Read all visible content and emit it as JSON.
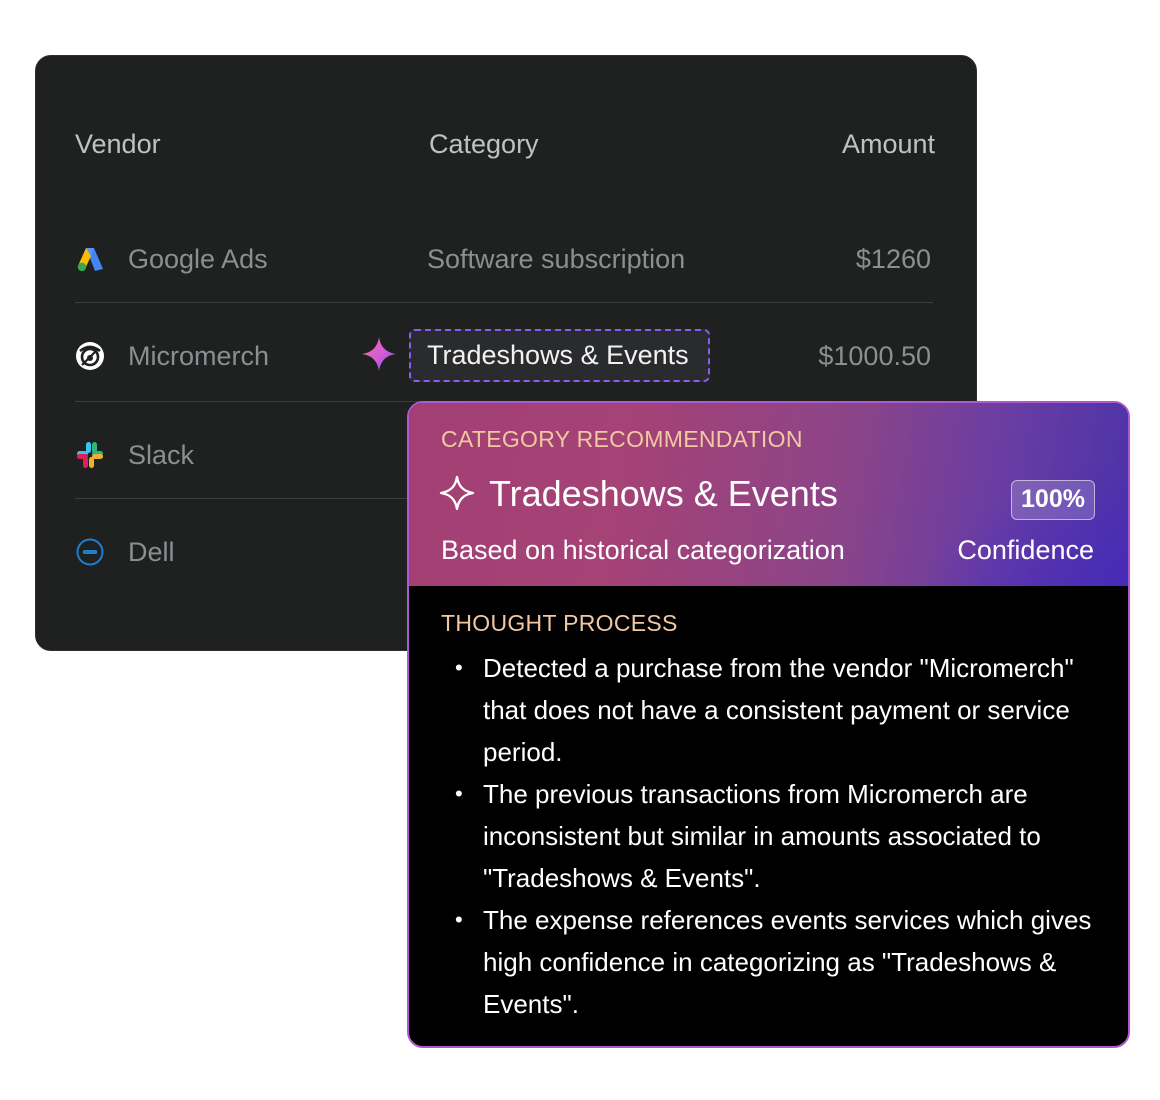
{
  "table": {
    "headers": {
      "vendor": "Vendor",
      "category": "Category",
      "amount": "Amount"
    },
    "rows": [
      {
        "vendor": "Google Ads",
        "icon": "google-ads-icon",
        "category": "Software subscription",
        "amount": "$1260"
      },
      {
        "vendor": "Micromerch",
        "icon": "micromerch-icon",
        "category": "Tradeshows & Events",
        "amount": "$1000.50"
      },
      {
        "vendor": "Slack",
        "icon": "slack-icon",
        "category": "",
        "amount": ""
      },
      {
        "vendor": "Dell",
        "icon": "dell-icon",
        "category": "",
        "amount": ""
      }
    ]
  },
  "recommendation": {
    "eyebrow": "CATEGORY RECOMMENDATION",
    "title": "Tradeshows & Events",
    "confidence_value": "100%",
    "subtitle": "Based on historical categorization",
    "confidence_label": "Confidence",
    "thought_title": "THOUGHT PROCESS",
    "thoughts": [
      "Detected a purchase from the vendor \"Micromerch\" that does not have a consistent payment or service period.",
      "The previous transactions from Micromerch are inconsistent but similar in amounts associated to \"Tradeshows & Events\".",
      "The expense references events services which gives high confidence in categorizing as \"Tradeshows & Events\"."
    ]
  },
  "colors": {
    "card_bg": "#1f2020",
    "chip_border": "#8c5cf0",
    "popover_border": "#b058d0",
    "eyebrow": "#f0c9a2"
  }
}
